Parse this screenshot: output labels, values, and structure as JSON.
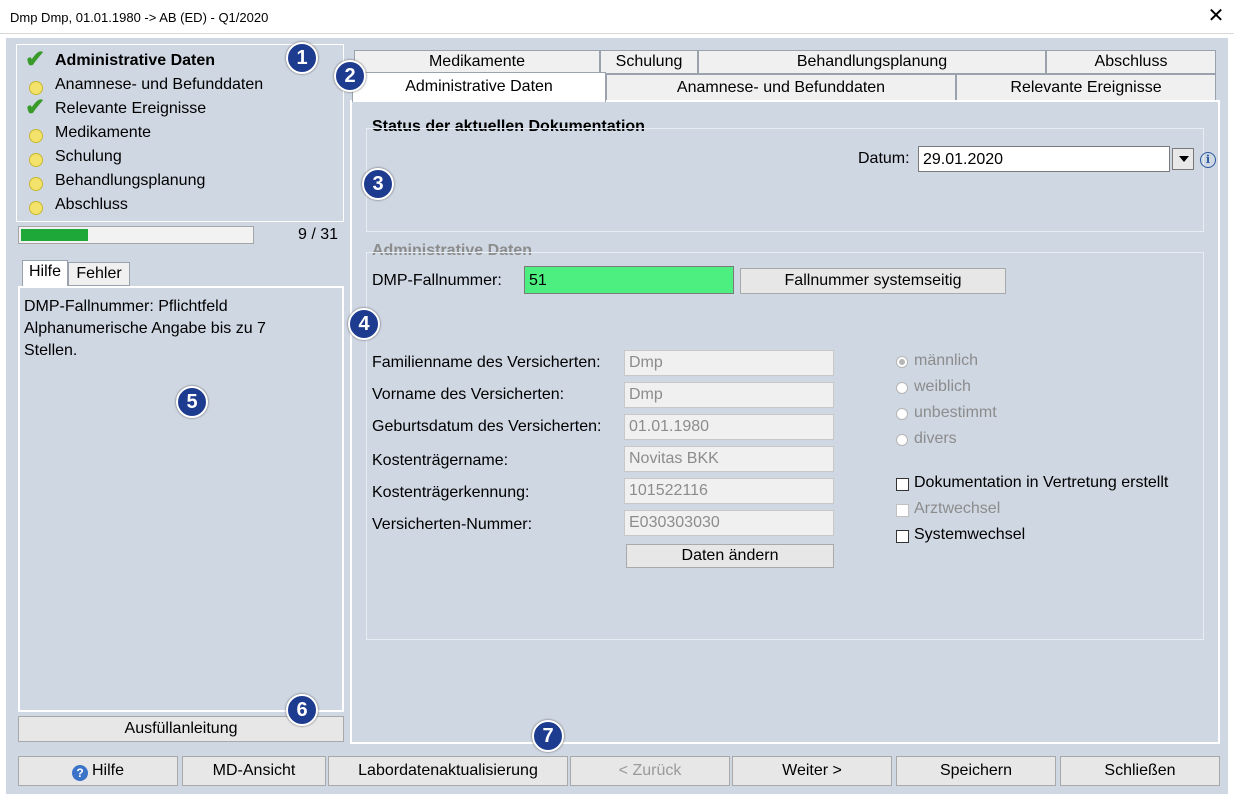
{
  "window": {
    "title": "Dmp Dmp, 01.01.1980 -> AB (ED) - Q1/2020"
  },
  "nav": {
    "items": [
      {
        "label": "Administrative Daten",
        "status": "done",
        "bold": true
      },
      {
        "label": "Anamnese- und Befunddaten",
        "status": "pending"
      },
      {
        "label": "Relevante Ereignisse",
        "status": "done"
      },
      {
        "label": "Medikamente",
        "status": "pending"
      },
      {
        "label": "Schulung",
        "status": "pending"
      },
      {
        "label": "Behandlungsplanung",
        "status": "pending"
      },
      {
        "label": "Abschluss",
        "status": "pending"
      }
    ],
    "progress_text": "9 / 31",
    "progress_fraction": 0.29,
    "progress_color": "#1fa83a"
  },
  "badges": {
    "b1": "1",
    "b2": "2",
    "b3": "3",
    "b4": "4",
    "b5": "5",
    "b6": "6",
    "b7": "7"
  },
  "helpPanel": {
    "tabs": [
      "Hilfe",
      "Fehler"
    ],
    "text_line1": "DMP-Fallnummer: Pflichtfeld",
    "text_line2": "Alphanumerische Angabe bis zu 7",
    "text_line3": "Stellen.",
    "button": "Ausfüllanleitung"
  },
  "tabs": {
    "row1": [
      "Medikamente",
      "Schulung",
      "Behandlungsplanung",
      "Abschluss"
    ],
    "row2": [
      "Administrative Daten",
      "Anamnese- und Befunddaten",
      "Relevante Ereignisse"
    ]
  },
  "status": {
    "heading": "Status der aktuellen Dokumentation",
    "datum_label": "Datum:",
    "datum_value": "29.01.2020"
  },
  "admin": {
    "heading": "Administrative Daten",
    "fallnummer_label": "DMP-Fallnummer:",
    "fallnummer_value": "51",
    "fallnummer_color": "#4def80",
    "fallnummer_button": "Fallnummer systemseitig",
    "fields": [
      {
        "label": "Familienname des Versicherten:",
        "value": "Dmp"
      },
      {
        "label": "Vorname des Versicherten:",
        "value": "Dmp"
      },
      {
        "label": "Geburtsdatum des Versicherten:",
        "value": "01.01.1980"
      },
      {
        "label": "Kostenträgername:",
        "value": "Novitas BKK"
      },
      {
        "label": "Kostenträgerkennung:",
        "value": "101522116"
      },
      {
        "label": "Versicherten-Nummer:",
        "value": "E030303030"
      }
    ],
    "change_button": "Daten ändern",
    "gender_options": [
      "männlich",
      "weiblich",
      "unbestimmt",
      "divers"
    ],
    "gender_selected": "männlich",
    "check_vertretung": "Dokumentation in Vertretung erstellt",
    "check_arztwechsel": "Arztwechsel",
    "check_systemwechsel": "Systemwechsel"
  },
  "bottom": {
    "hilfe": "Hilfe",
    "md": "MD-Ansicht",
    "labor": "Labordatenaktualisierung",
    "zurueck": "< Zurück",
    "weiter": "Weiter >",
    "speichern": "Speichern",
    "schliessen": "Schließen"
  }
}
